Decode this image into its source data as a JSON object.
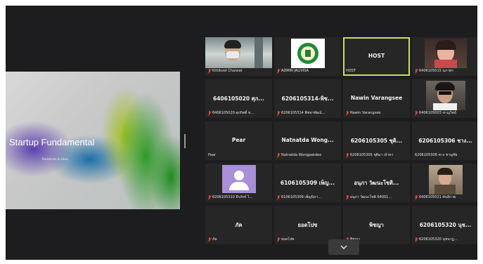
{
  "share": {
    "title": "Startup Fundamental",
    "subtitle": "Resources & Ideas"
  },
  "tiles": [
    {
      "name": "",
      "label": "Kittikoot Chaiwat"
    },
    {
      "name": "",
      "label": "ADMIN JALIVISA"
    },
    {
      "name": "HOST",
      "label": "HOST"
    },
    {
      "name": "",
      "label": "6406105015 นภาพร"
    },
    {
      "name": "6406105020 ศุภ...",
      "label": "6406105020 ศุภกิตติ์ ท..."
    },
    {
      "name": "6206105314-พิช...",
      "label": "6206105314 พิชชาพัฒน์..."
    },
    {
      "name": "Nawin Varangsee",
      "label": "Nawin Varangsee"
    },
    {
      "name": "",
      "label": "6406105003 ชาญวิทย์"
    },
    {
      "name": "Pear",
      "label": "Pear"
    },
    {
      "name": "Natnatda Wong...",
      "label": "Natnatda Wongpakdee"
    },
    {
      "name": "6206105305 ชุติ...",
      "label": "6206105305 ชุติมา เจ้าทา"
    },
    {
      "name": "6206105306 ชาง...",
      "label": "6206105306 ชาง ชาญชัย"
    },
    {
      "name": "",
      "label": "6206105310 ธีรภัทร์ ไ..."
    },
    {
      "name": "6106105309 เพ็ญ...",
      "label": "6106105309 เพ็ญนิภา..."
    },
    {
      "name": "อนุภา วัฒนะโชติ...",
      "label": "อนุภา วัฒนะโชติ 64001..."
    },
    {
      "name": "",
      "label": "6406105021 ศันสิกาพ"
    },
    {
      "name": "ภัค",
      "label": "ภัค"
    },
    {
      "name": "ยอดโปซ",
      "label": "ยอดโปซ"
    },
    {
      "name": "พิชญา",
      "label": "พิชญา"
    },
    {
      "name": "6206105320 นุช...",
      "label": "6206105320 นุชนาฏ..."
    }
  ]
}
